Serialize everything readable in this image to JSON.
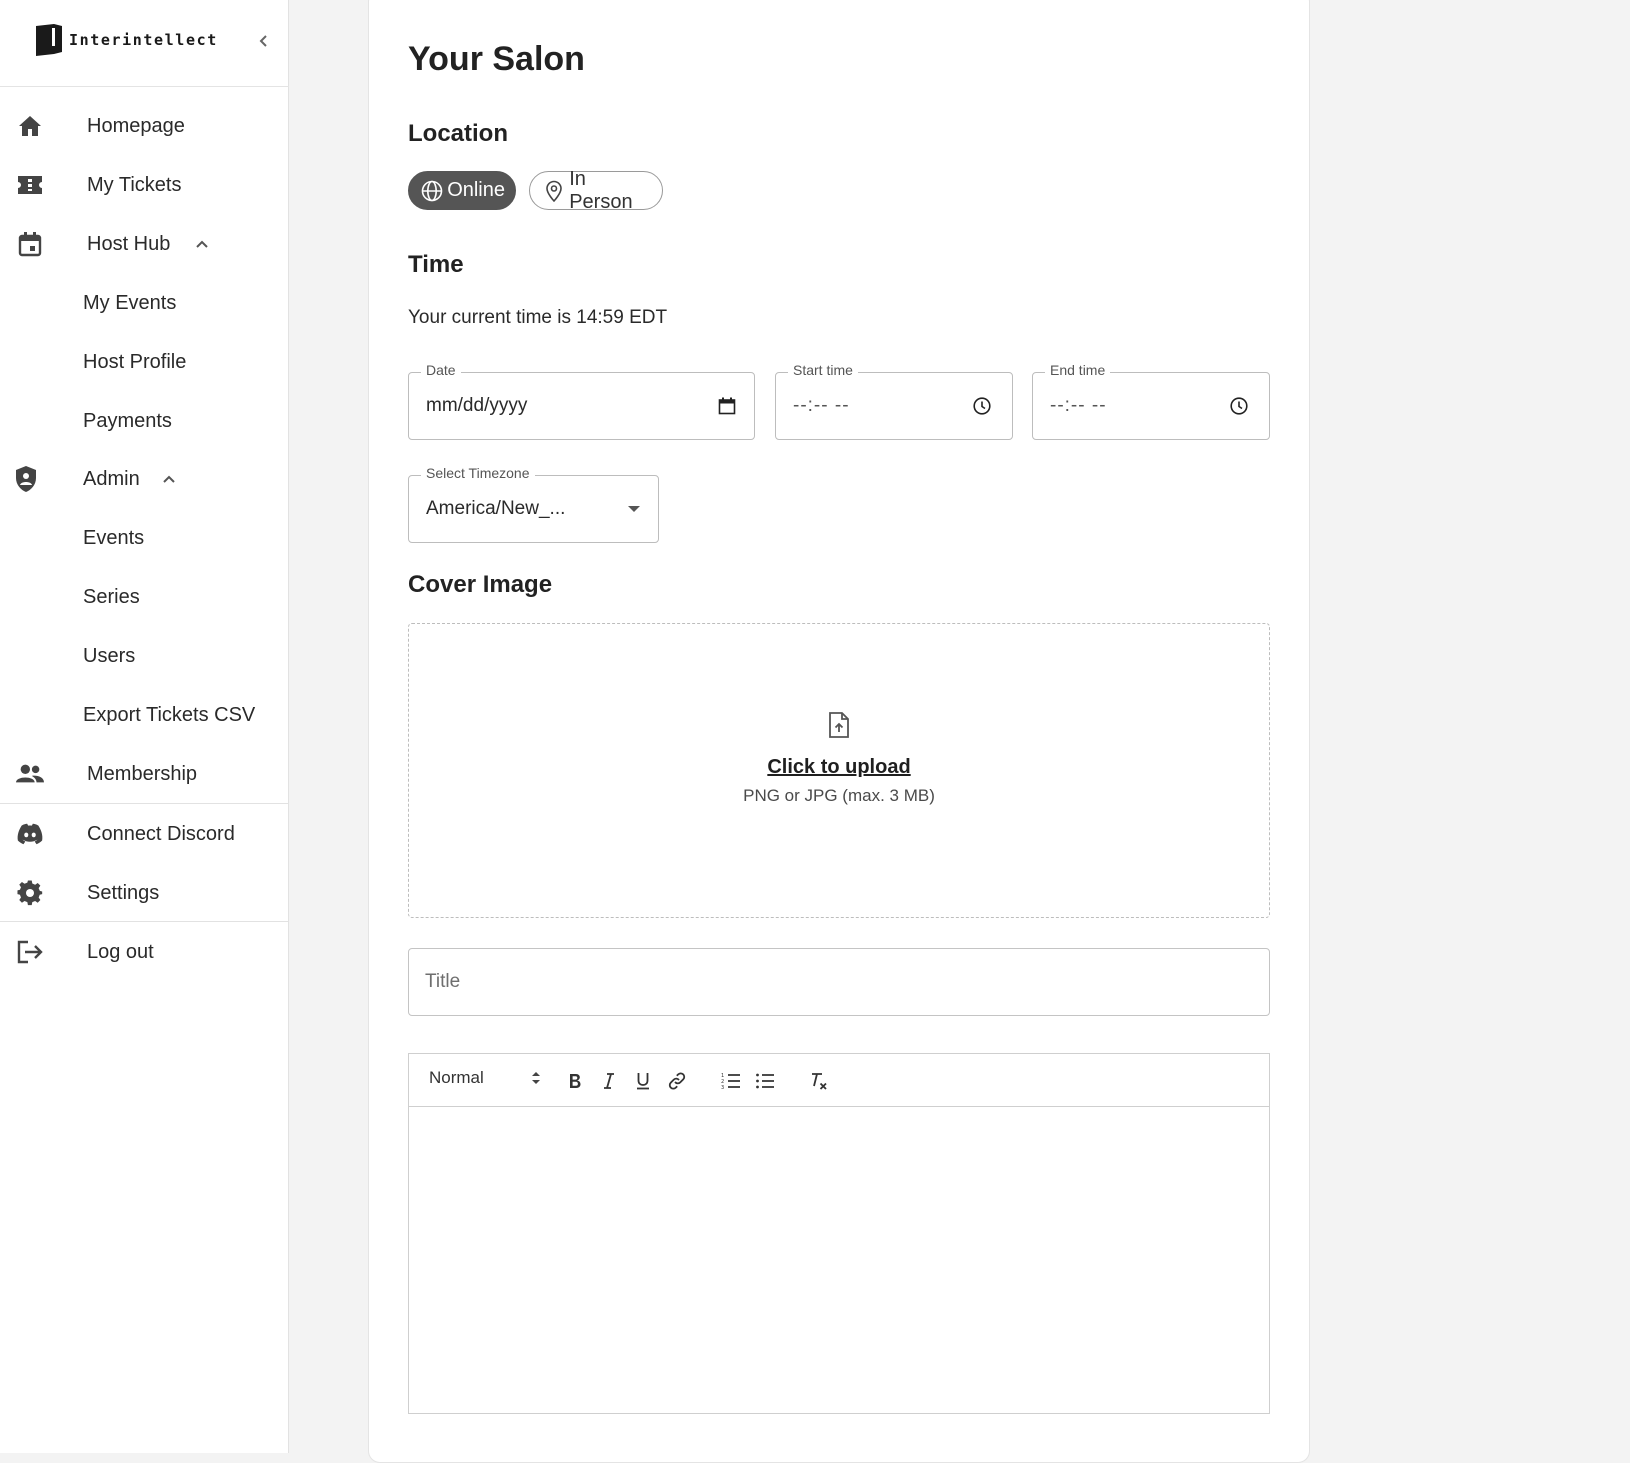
{
  "brand": {
    "name": "Interintellect"
  },
  "sidebar": {
    "items": [
      {
        "label": "Homepage"
      },
      {
        "label": "My Tickets"
      },
      {
        "label": "Host Hub"
      },
      {
        "label": "My Events"
      },
      {
        "label": "Host Profile"
      },
      {
        "label": "Payments"
      },
      {
        "label": "Admin"
      },
      {
        "label": "Events"
      },
      {
        "label": "Series"
      },
      {
        "label": "Users"
      },
      {
        "label": "Export Tickets CSV"
      },
      {
        "label": "Membership"
      },
      {
        "label": "Connect Discord"
      },
      {
        "label": "Settings"
      },
      {
        "label": "Log out"
      }
    ]
  },
  "main": {
    "title": "Your Salon",
    "location": {
      "heading": "Location",
      "options": [
        {
          "label": "Online",
          "selected": true
        },
        {
          "label": "In Person",
          "selected": false
        }
      ]
    },
    "time": {
      "heading": "Time",
      "current_time": "Your current time is 14:59 EDT",
      "date": {
        "label": "Date",
        "placeholder": "mm/dd/yyyy"
      },
      "start": {
        "label": "Start time",
        "placeholder": "--:-- --"
      },
      "end": {
        "label": "End time",
        "placeholder": "--:-- --"
      },
      "timezone": {
        "label": "Select Timezone",
        "value": "America/New_..."
      }
    },
    "cover": {
      "heading": "Cover Image",
      "upload_label": "Click to upload",
      "upload_hint": "PNG or JPG (max. 3 MB)"
    },
    "title_field": {
      "placeholder": "Title"
    },
    "editor": {
      "format_value": "Normal"
    }
  },
  "colors": {
    "selected_pill": "#555555",
    "page_background": "#f3f3f3",
    "border": "#bdbdbd"
  }
}
